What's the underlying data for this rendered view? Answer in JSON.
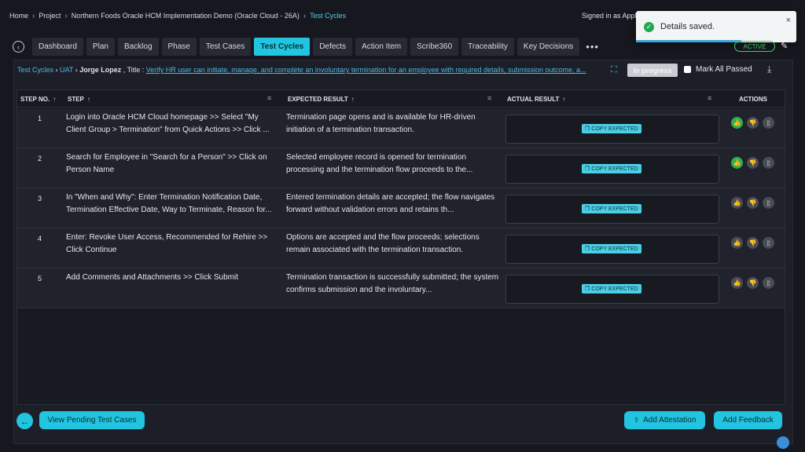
{
  "breadcrumb": [
    "Home",
    "Project",
    "Northern Foods Oracle HCM Implementation Demo (Oracle Cloud - 26A)",
    "Test Cycles"
  ],
  "signed_in": "Signed in as Appli",
  "toast": {
    "message": "Details saved.",
    "close": "×"
  },
  "tabs": [
    "Dashboard",
    "Plan",
    "Backlog",
    "Phase",
    "Test Cases",
    "Test Cycles",
    "Defects",
    "Action Item",
    "Scribe360",
    "Traceability",
    "Key Decisions"
  ],
  "active_tab": "Test Cycles",
  "more": "•••",
  "status_pill": "ACTIVE",
  "context": {
    "cycle": "Test Cycles",
    "phase": "UAT",
    "user": "Jorge Lopez",
    "title_label": " , Title : ",
    "title": "Verify HR user can initiate, manage, and complete an involuntary termination for an employee with required details, submission outcome, a..."
  },
  "status_button": "In progress",
  "mark_all": "Mark All Passed",
  "columns": {
    "step_no": "STEP NO.",
    "step": "STEP",
    "expected": "EXPECTED RESULT",
    "actual": "ACTUAL RESULT",
    "actions": "ACTIONS"
  },
  "copy_label": "COPY EXPECTED",
  "rows": [
    {
      "num": "1",
      "step": "Login into Oracle HCM Cloud homepage >> Select \"My Client Group > Termination\" from Quick Actions >> Click ...",
      "expected": "Termination page opens and is available for HR-driven initiation of a termination transaction.",
      "thumbs_up_active": true
    },
    {
      "num": "2",
      "step": "Search for Employee in \"Search for a Person\" >> Click on Person Name",
      "expected": "Selected employee record is opened for termination processing and the termination flow proceeds to the...",
      "thumbs_up_active": true
    },
    {
      "num": "3",
      "step": "In \"When and Why\": Enter Termination Notification Date, Termination Effective Date, Way to Terminate, Reason for...",
      "expected": "Entered termination details are accepted; the flow navigates forward without validation errors and retains th...",
      "thumbs_up_active": false
    },
    {
      "num": "4",
      "step": "Enter: Revoke User Access, Recommended for Rehire >> Click Continue",
      "expected": "Options are accepted and the flow proceeds; selections remain associated with the termination transaction.",
      "thumbs_up_active": false
    },
    {
      "num": "5",
      "step": "Add Comments and Attachments >> Click Submit",
      "expected": "Termination transaction is successfully submitted; the system confirms submission and the involuntary...",
      "thumbs_up_active": false
    }
  ],
  "footer": {
    "pending": "View Pending Test Cases",
    "attestation": "Add Attestation",
    "feedback": "Add Feedback"
  },
  "colors": {
    "accent": "#22c5e0",
    "success": "#2fb14f",
    "link": "#4fb7e0"
  }
}
